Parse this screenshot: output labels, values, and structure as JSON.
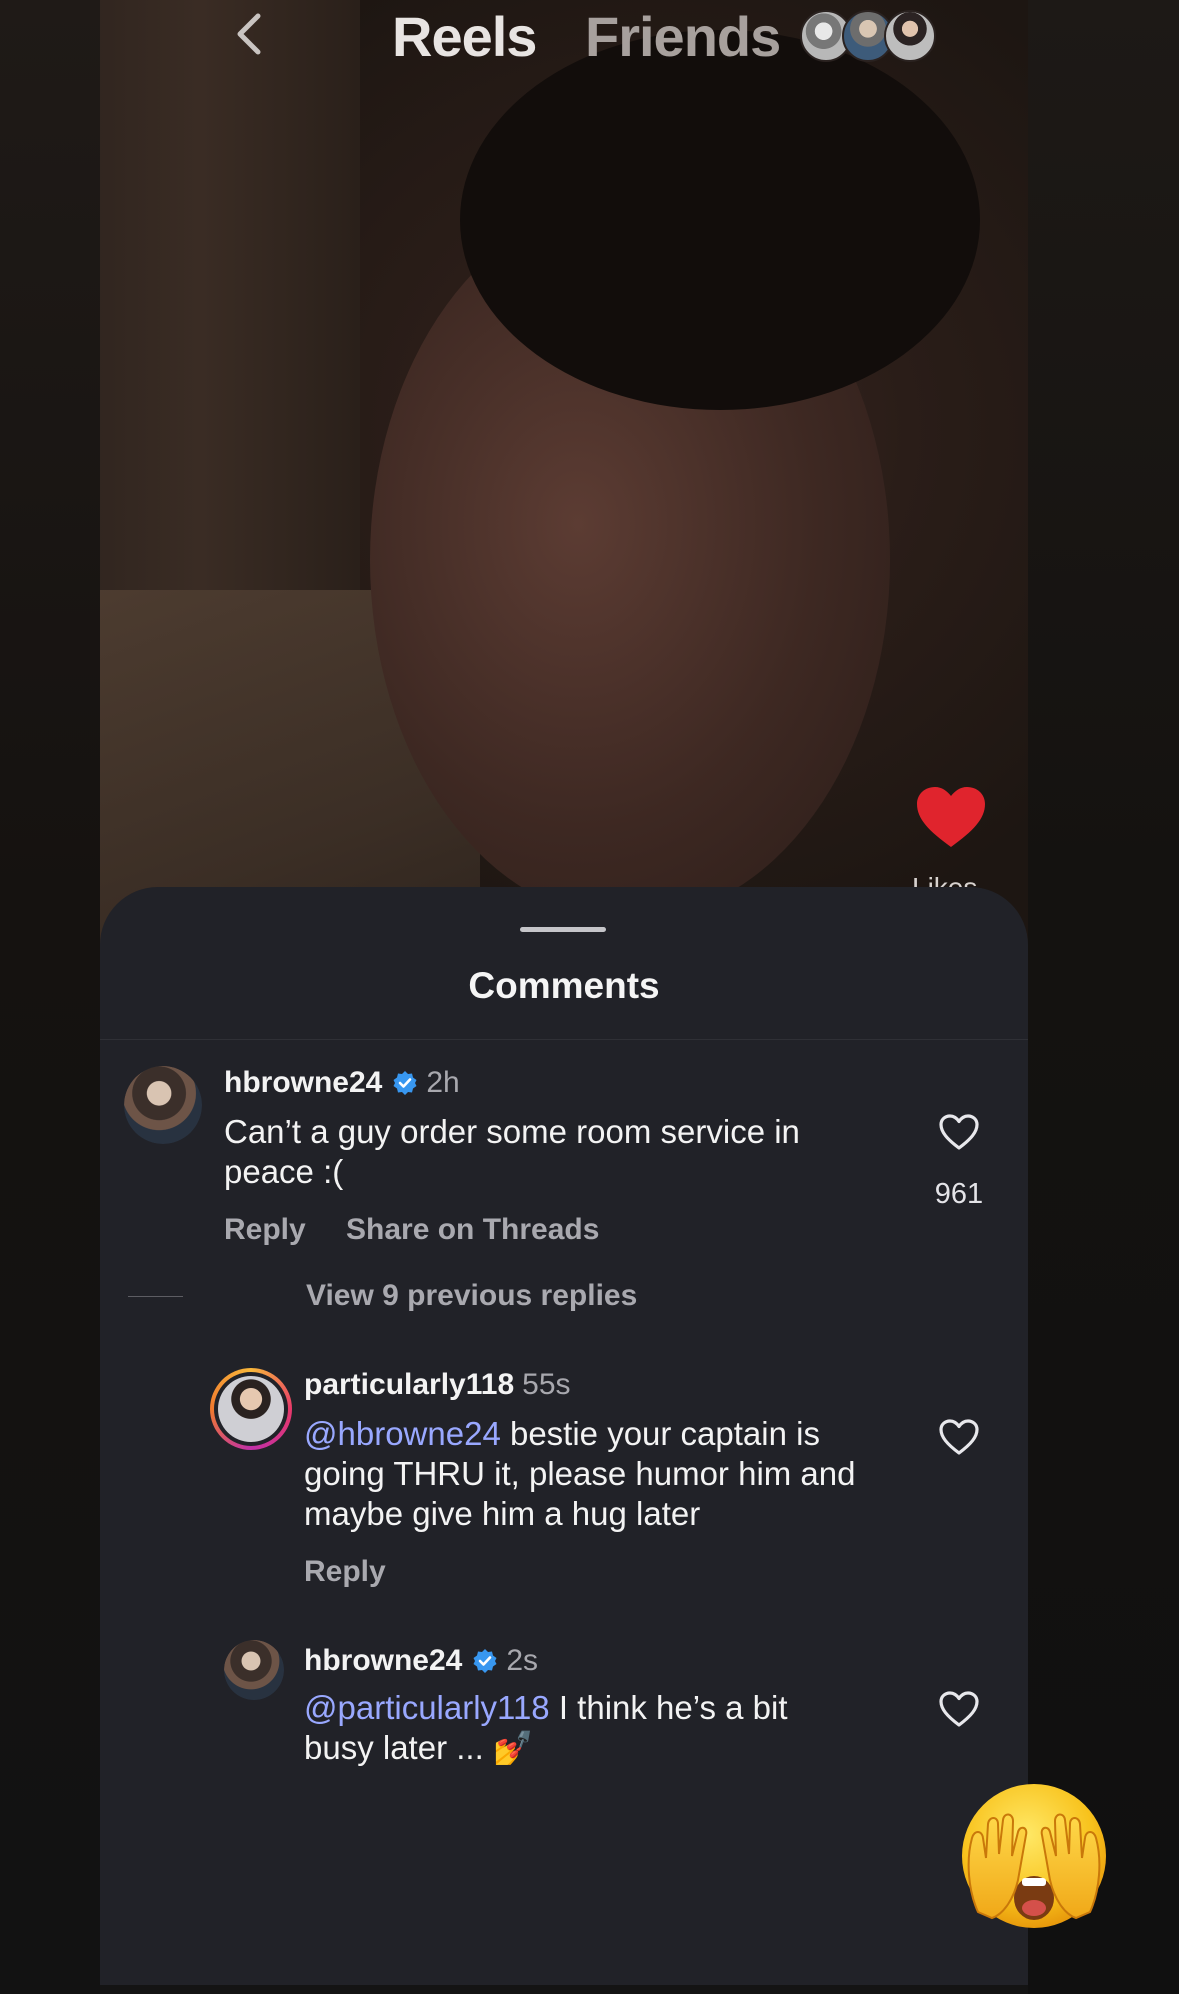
{
  "header": {
    "back_icon": "chevron-left-icon",
    "tabs": [
      {
        "label": "Reels",
        "active": true
      },
      {
        "label": "Friends",
        "active": false
      }
    ],
    "friend_avatars_icon": "friends-avatars-icon"
  },
  "video": {
    "likes_label": "Likes",
    "likes_icon": "heart-filled-icon",
    "liked_color": "#e0242d"
  },
  "comments_sheet": {
    "title": "Comments",
    "comments": [
      {
        "username": "hbrowne24",
        "verified": true,
        "time": "2h",
        "text": "Can’t a guy order some room service in peace :(",
        "likes": "961",
        "actions": [
          "Reply",
          "Share on Threads"
        ]
      }
    ],
    "view_replies": "View 9 previous replies",
    "replies": [
      {
        "username": "particularly118",
        "time": "55s",
        "mention": "@hbrowne24",
        "text": "bestie your captain is going THRU it, please humor him and maybe give him a hug later",
        "action": "Reply",
        "has_story_ring": true
      },
      {
        "username": "hbrowne24",
        "verified": true,
        "time": "2s",
        "mention": "@particularly118",
        "text": "I think he’s a bit busy later ...",
        "emoji": "💅"
      }
    ]
  },
  "sticker": {
    "emoji_icon": "face-with-hands-over-eyes-emoji"
  },
  "colors": {
    "sheet_bg": "#212228",
    "mention": "#99a8ff",
    "verified": "#3897f0",
    "secondary_text": "#a9a9af"
  }
}
